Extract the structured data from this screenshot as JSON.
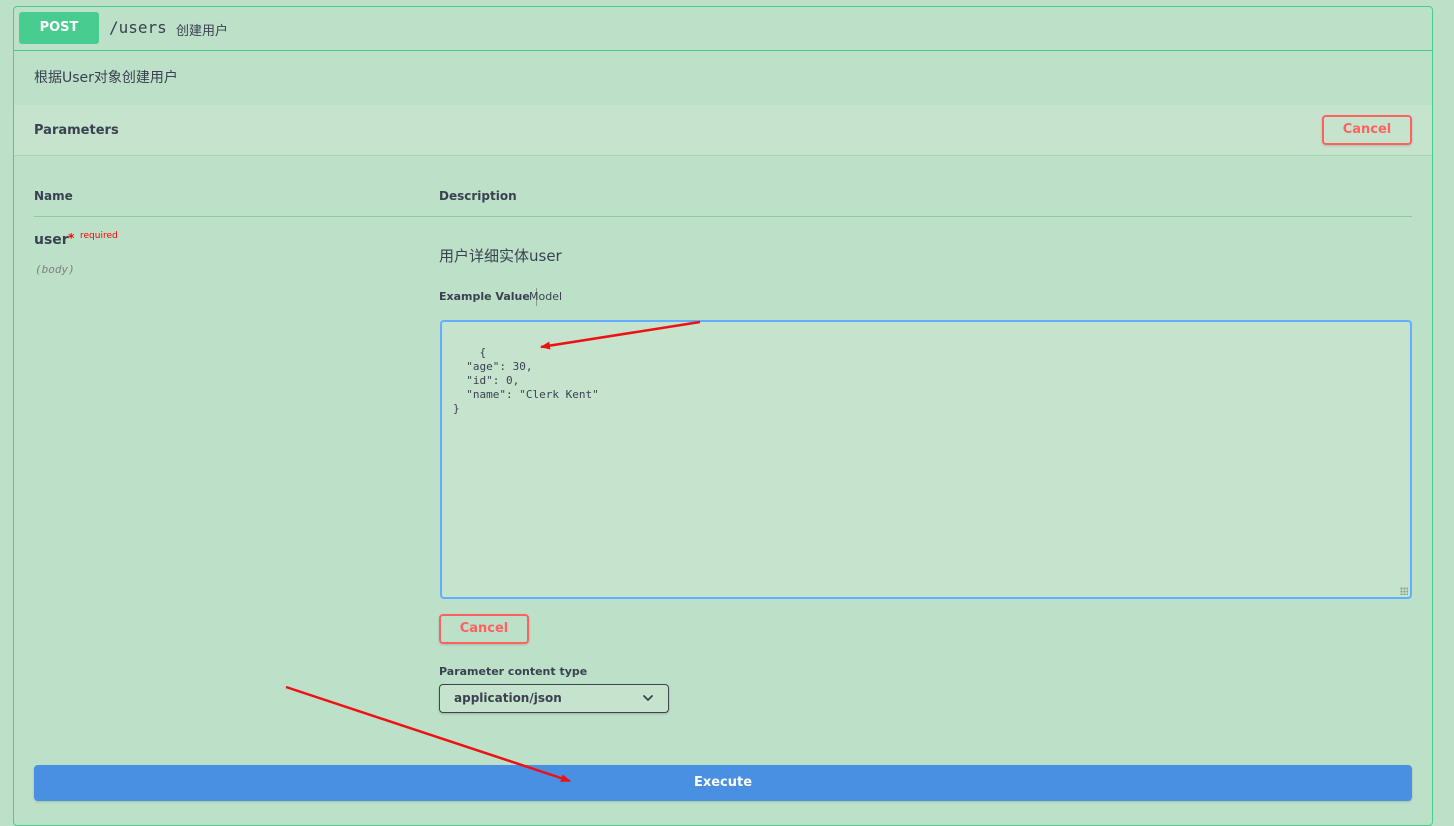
{
  "operation": {
    "method": "POST",
    "path": "/users",
    "summary": "创建用户",
    "description": "根据User对象创建用户"
  },
  "parameters": {
    "title": "Parameters",
    "cancel_label": "Cancel",
    "columns": {
      "name": "Name",
      "description": "Description"
    },
    "param": {
      "name": "user",
      "required_star": "*",
      "required_label": "required",
      "in": "(body)",
      "description": "用户详细实体user"
    },
    "tabs": {
      "example": "Example Value",
      "model": "Model"
    },
    "body_value": "{\n  \"age\": 30,\n  \"id\": 0,\n  \"name\": \"Clerk Kent\"\n}",
    "cancel_label_bottom": "Cancel",
    "content_type_label": "Parameter content type",
    "content_type_selected": "application/json"
  },
  "execute_label": "Execute",
  "colors": {
    "post_green": "#49cc90",
    "cancel_red": "#ff6060",
    "execute_blue": "#4990e2",
    "editor_focus": "#61affe",
    "annotation_arrow": "#ee1111"
  }
}
